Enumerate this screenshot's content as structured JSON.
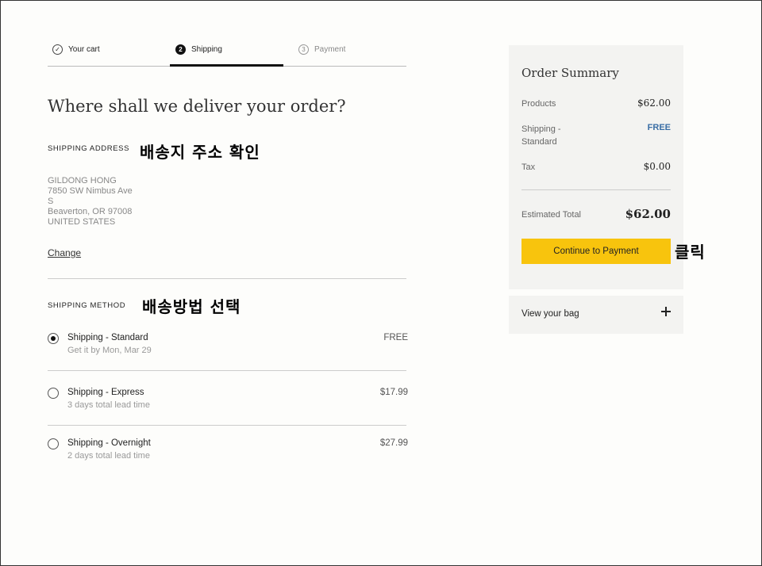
{
  "stepper": {
    "steps": [
      {
        "label": "Your cart",
        "marker": "✓"
      },
      {
        "label": "Shipping",
        "marker": "2"
      },
      {
        "label": "Payment",
        "marker": "3"
      }
    ],
    "active_index": 1
  },
  "headline": "Where shall we deliver your order?",
  "shipping_address": {
    "label": "SHIPPING ADDRESS",
    "annotation": "배송지 주소 확인",
    "lines": [
      "GILDONG HONG",
      "7850 SW Nimbus Ave",
      "S",
      "Beaverton, OR 97008",
      "UNITED STATES"
    ],
    "change_label": "Change"
  },
  "shipping_method": {
    "label": "SHIPPING METHOD",
    "annotation": "배송방법 선택",
    "options": [
      {
        "name": "Shipping - Standard",
        "sub": "Get it by Mon, Mar 29",
        "price": "FREE",
        "selected": true
      },
      {
        "name": "Shipping - Express",
        "sub": "3 days total lead time",
        "price": "$17.99",
        "selected": false
      },
      {
        "name": "Shipping - Overnight",
        "sub": "2 days total lead time",
        "price": "$27.99",
        "selected": false
      }
    ]
  },
  "summary": {
    "title": "Order Summary",
    "products_label": "Products",
    "products_value": "$62.00",
    "shipping_label": "Shipping - Standard",
    "shipping_value": "FREE",
    "tax_label": "Tax",
    "tax_value": "$0.00",
    "estimated_label": "Estimated Total",
    "estimated_value": "$62.00",
    "button_label": "Continue to Payment",
    "button_annotation": "클릭"
  },
  "bag": {
    "label": "View your bag"
  },
  "colors": {
    "accent_button": "#f8c40d",
    "free_text": "#3a6ea5"
  }
}
